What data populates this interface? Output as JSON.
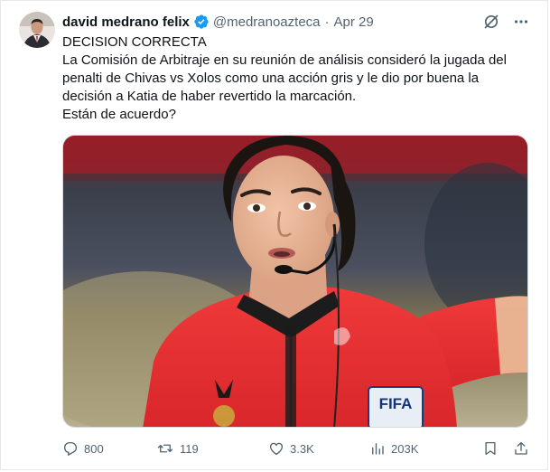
{
  "author": {
    "display_name": "david medrano felix",
    "handle": "@medranoazteca",
    "separator": "·",
    "date": "Apr 29",
    "avatar_icon": "avatar-portrait",
    "verified_icon": "verified-badge-icon"
  },
  "tweet": {
    "lines": [
      "DECISION CORRECTA",
      "La Comisión de Arbitraje en su reunión de análisis consideró la jugada del",
      "penalti de Chivas vs Xolos como una acción gris y  le dio por buena la",
      "decisión a Katia de haber revertido la marcación.",
      "Están de acuerdo?"
    ]
  },
  "media": {
    "badge_text": "FIFA"
  },
  "actions": {
    "replies": "800",
    "retweets": "119",
    "likes": "3.3K",
    "views": "203K"
  },
  "colors": {
    "text_primary": "#0f1419",
    "text_secondary": "#536471",
    "verified_blue": "#1d9bf0",
    "border": "#cfd9de"
  }
}
